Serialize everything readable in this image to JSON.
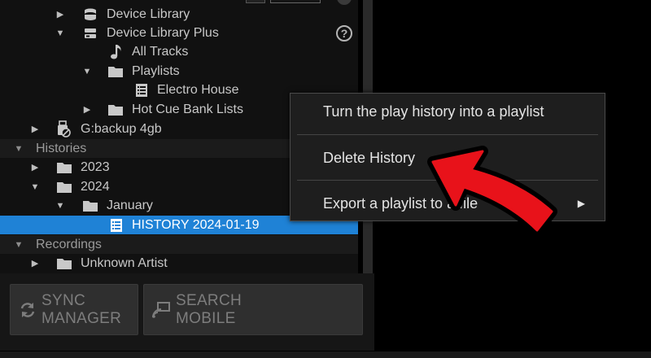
{
  "tree": {
    "device_library": "Device Library",
    "device_library_plus": "Device Library Plus",
    "all_tracks": "All Tracks",
    "playlists": "Playlists",
    "electro_house": "Electro House",
    "hot_cue_bank_lists": "Hot Cue Bank Lists",
    "backup_drive": "G:backup 4gb",
    "histories": "Histories",
    "year_2023": "2023",
    "year_2024": "2024",
    "january": "January",
    "history_item": "HISTORY 2024-01-19",
    "recordings": "Recordings",
    "unknown_artist": "Unknown Artist"
  },
  "help_icon_glyph": "?",
  "toolbar": {
    "sync_manager_line1": "SYNC",
    "sync_manager_line2": "MANAGER",
    "search_mobile_line1": "SEARCH",
    "search_mobile_line2": "MOBILE"
  },
  "context_menu": {
    "items": [
      {
        "label": "Turn the play history into a playlist"
      },
      {
        "label": "Delete History"
      },
      {
        "label": "Export a playlist to a file",
        "submenu_glyph": "▶"
      }
    ]
  },
  "colors": {
    "selection": "#1f82d6",
    "annotation_arrow": "#e8121a"
  },
  "icons": {
    "expanded_glyph": "▼",
    "collapsed_glyph": "▶"
  }
}
